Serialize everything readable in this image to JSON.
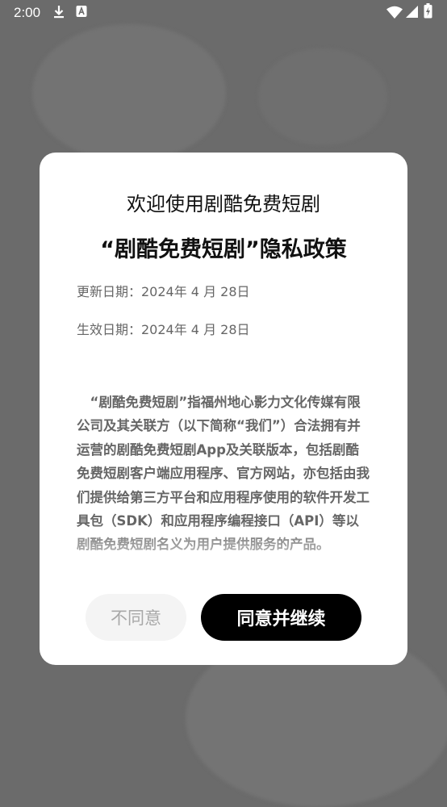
{
  "status_bar": {
    "time": "2:00",
    "icons": [
      "download-icon",
      "app-notification-icon",
      "wifi-icon",
      "signal-icon",
      "battery-icon"
    ]
  },
  "dialog": {
    "title_line1": "欢迎使用剧酷免费短剧",
    "title_line2": "“剧酷免费短剧”隐私政策",
    "updated_date": "更新日期：2024年 4 月 28日",
    "effective_date": "生效日期：2024年 4 月 28日",
    "body": "“剧酷免费短剧”指福州地心影力文化传媒有限公司及其关联方（以下简称“我们”）合法拥有并运营的剧酷免费短剧App及关联版本，包括剧酷免费短剧客户端应用程序、官方网站，亦包括由我们提供给第三方平台和应用程序使用的软件开发工具包（SDK）和应用程序编程接口（API）等以剧酷免费短剧名义为用户提供服务的产品。",
    "disagree_label": "不同意",
    "agree_label": "同意并继续"
  },
  "colors": {
    "scrim": "#6b6b6b",
    "dialog_bg": "#ffffff",
    "agree_bg": "#000000",
    "disagree_bg": "#f4f4f4",
    "muted_text": "#666666"
  }
}
